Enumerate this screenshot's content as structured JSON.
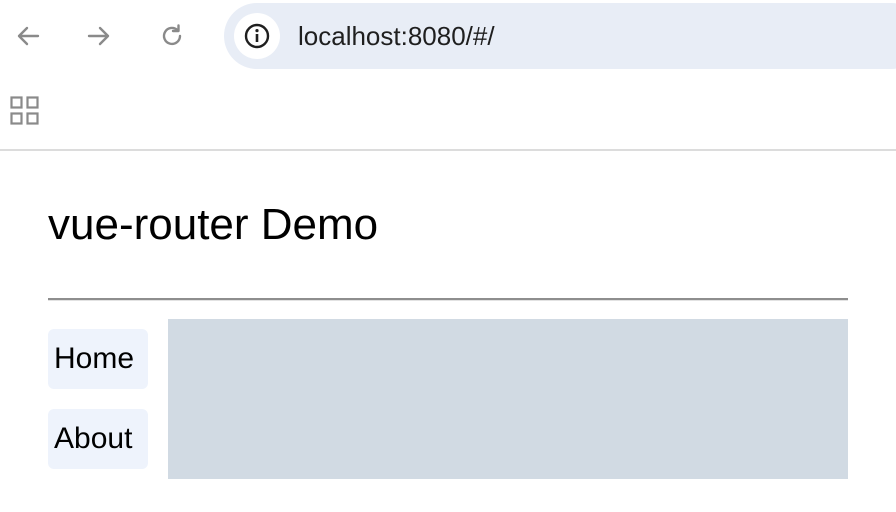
{
  "browser": {
    "icons": {
      "back": "arrow-left-icon",
      "forward": "arrow-right-icon",
      "reload": "reload-icon",
      "site_info": "info-icon",
      "apps": "apps-grid-icon"
    },
    "url": "localhost:8080/#/"
  },
  "page": {
    "title": "vue-router Demo",
    "nav_links": [
      {
        "label": "Home"
      },
      {
        "label": "About"
      }
    ],
    "colors": {
      "link_background": "#eef3fc",
      "router_view_background": "#d1dae3",
      "omnibox_background": "#e8edf6"
    }
  }
}
